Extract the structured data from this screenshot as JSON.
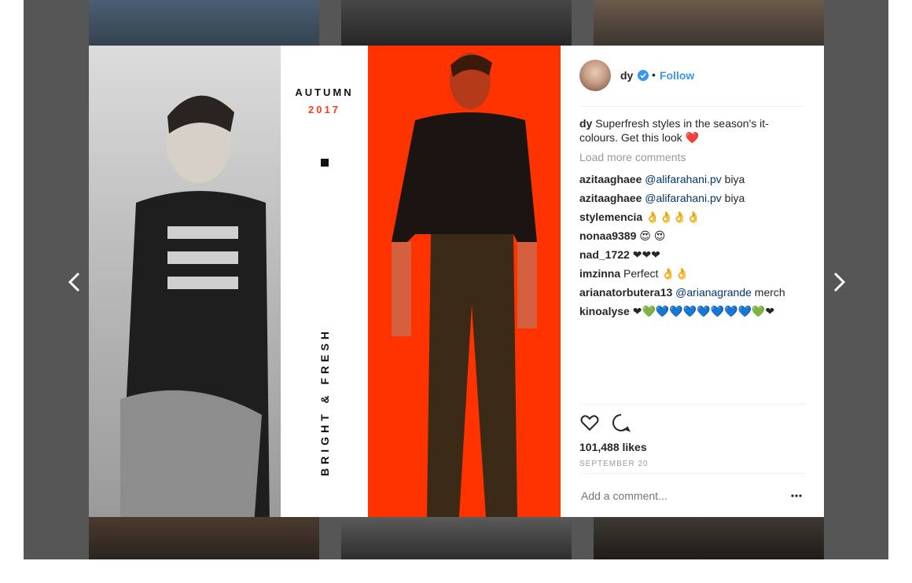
{
  "post": {
    "username": "dy",
    "follow_label": "Follow",
    "separator": "•",
    "caption_user": "dy",
    "caption_text": "Superfresh styles in the season's it-colours. Get this look ❤️",
    "load_more": "Load more comments",
    "likes": "101,488 likes",
    "date": "SEPTEMBER 20",
    "add_comment_placeholder": "Add a comment..."
  },
  "artwork": {
    "season": "AUTUMN",
    "year": "2017",
    "vertical_text": "BRIGHT & FRESH"
  },
  "comments": [
    {
      "user": "azitaaghaee",
      "mention": "@alifarahani.pv",
      "text": "biya"
    },
    {
      "user": "azitaaghaee",
      "mention": "@alifarahani.pv",
      "text": "biya"
    },
    {
      "user": "stylemencia",
      "mention": "",
      "text": "👌👌👌👌"
    },
    {
      "user": "nonaa9389",
      "mention": "",
      "text": "😍 😍"
    },
    {
      "user": "nad_1722",
      "mention": "",
      "text": "❤❤❤"
    },
    {
      "user": "imzinna",
      "mention": "",
      "text": "Perfect 👌👌"
    },
    {
      "user": "arianatorbutera13",
      "mention": "@arianagrande",
      "text": "merch"
    },
    {
      "user": "kinoalyse",
      "mention": "",
      "text": "❤💚💙💙💙💙💙💙💙💚❤"
    }
  ],
  "colors": {
    "accent_red": "#ff3b1a",
    "link_blue": "#3897f0",
    "mention_blue": "#003569",
    "backdrop": "#565656"
  },
  "icons": [
    "chevron-left-icon",
    "chevron-right-icon",
    "verified-badge-icon",
    "heart-icon",
    "comment-icon",
    "more-options-icon"
  ]
}
